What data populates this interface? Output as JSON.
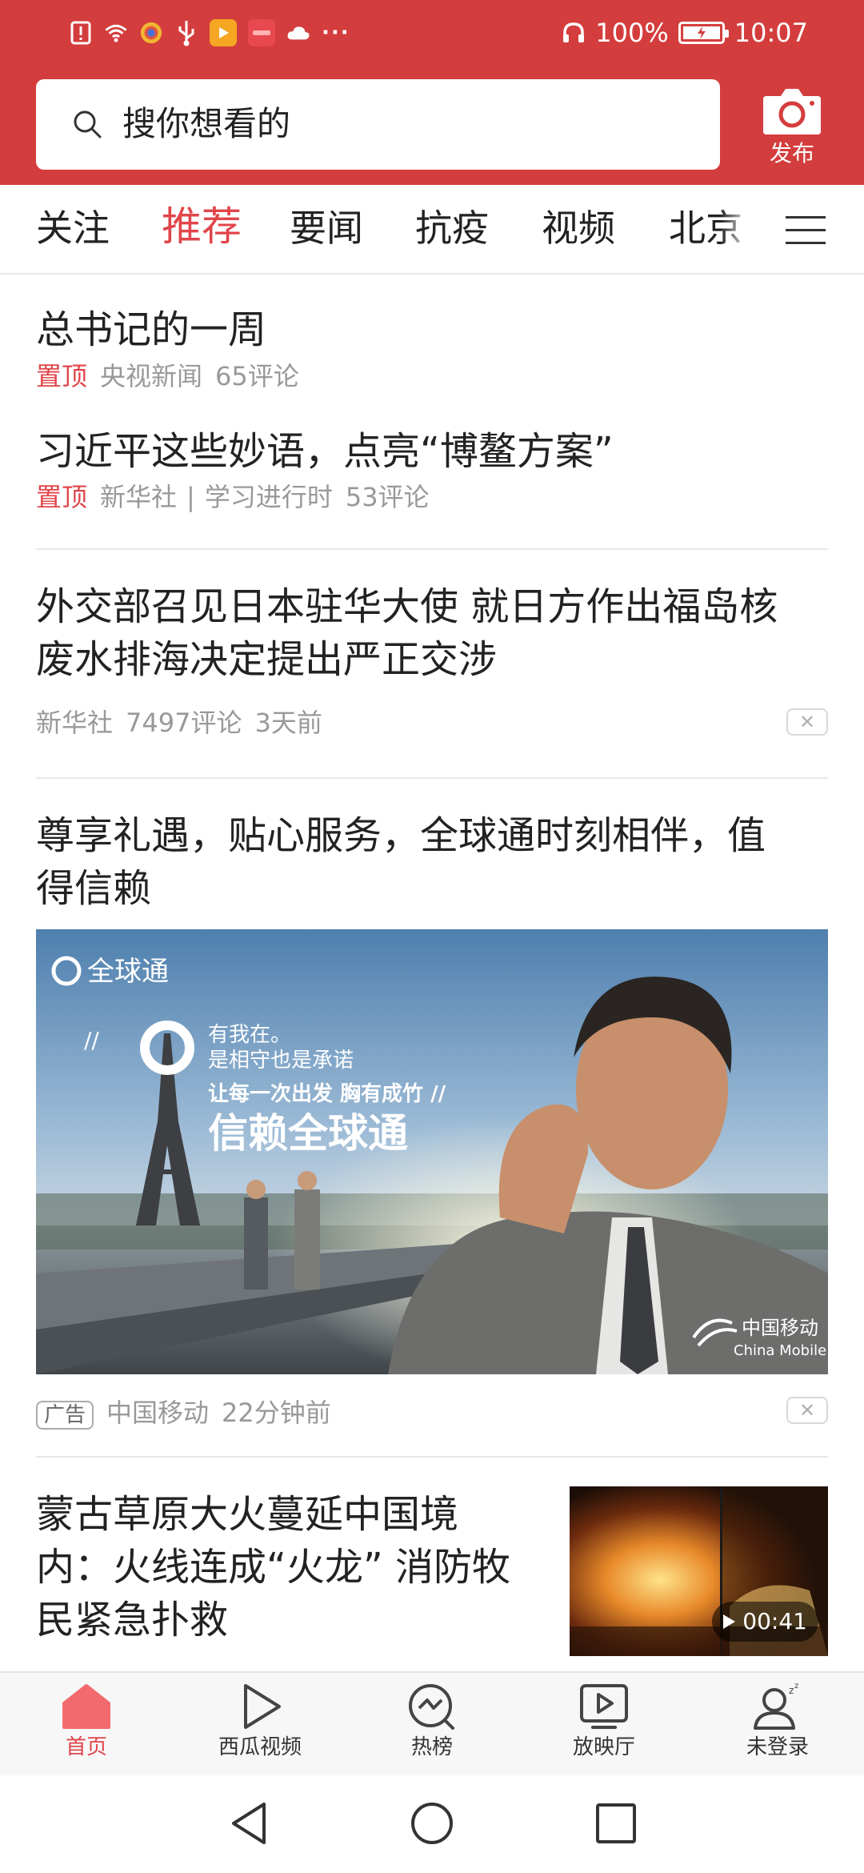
{
  "status_bar": {
    "left_icons": [
      "alert-icon",
      "wifi-icon",
      "camera-app-icon",
      "usb-icon",
      "video-app-icon",
      "huawei-app-icon",
      "cloud-icon"
    ],
    "more": "···",
    "battery_percent": "100%",
    "time": "10:07"
  },
  "header": {
    "search_placeholder": "搜你想看的",
    "publish_label": "发布"
  },
  "tabs": [
    {
      "label": "关注",
      "active": false
    },
    {
      "label": "推荐",
      "active": true
    },
    {
      "label": "要闻",
      "active": false
    },
    {
      "label": "抗疫",
      "active": false
    },
    {
      "label": "视频",
      "active": false
    },
    {
      "label": "北京",
      "active": false
    }
  ],
  "feed": {
    "pinned": [
      {
        "title": "总书记的一周",
        "tag": "置顶",
        "source": "央视新闻",
        "comments": "65评论"
      },
      {
        "title": "习近平这些妙语，点亮“博鳌方案”",
        "tag": "置顶",
        "source": "新华社",
        "separator": "|",
        "channel": "学习进行时",
        "comments": "53评论"
      }
    ],
    "article_1": {
      "title_line1": "外交部召见日本驻华大使 就日方作出福岛核",
      "title_line2": "废水排海决定提出严正交涉",
      "source": "新华社",
      "comments": "7497评论",
      "time": "3天前",
      "dislike": "✕"
    },
    "ad": {
      "title_line1": "尊享礼遇，贴心服务，全球通时刻相伴，值",
      "title_line2": "得信赖",
      "badge": "广告",
      "source": "中国移动",
      "time": "22分钟前",
      "dislike": "✕",
      "image": {
        "brand": "全球通",
        "slash_left": "//",
        "line1": "有我在。",
        "line2": "是相守也是承诺",
        "line3": "让每一次出发 胸有成竹 //",
        "headline": "信赖全球通",
        "logo_cn": "中国移动",
        "logo_en": "China Mobile"
      }
    },
    "article_2": {
      "title_line1": "蒙古草原大火蔓延中国境",
      "title_line2": "内：火线连成“火龙” 消防牧",
      "title_line3": "民紧急扑救",
      "duration": "00:41"
    }
  },
  "bottom_nav": [
    {
      "label": "首页",
      "icon": "home-icon",
      "active": true
    },
    {
      "label": "西瓜视频",
      "icon": "play-icon",
      "active": false
    },
    {
      "label": "热榜",
      "icon": "trending-icon",
      "active": false
    },
    {
      "label": "放映厅",
      "icon": "theater-icon",
      "active": false
    },
    {
      "label": "未登录",
      "icon": "user-icon",
      "active": false
    }
  ],
  "colors": {
    "brand_red": "#d43d3d",
    "accent_red": "#e0454a",
    "meta_gray": "#999999"
  }
}
